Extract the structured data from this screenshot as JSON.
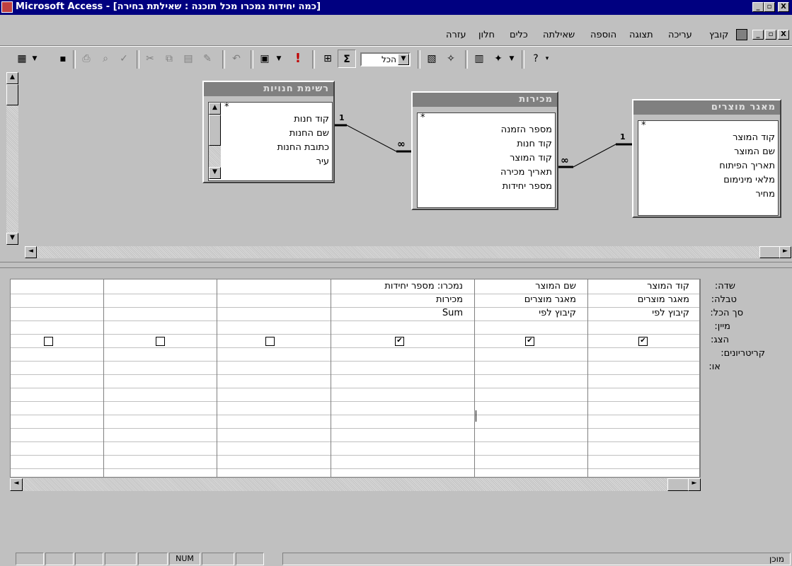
{
  "window": {
    "title": "Microsoft Access - [כמה יחידות נמכרו מכל תוכנה : שאילתת בחירה]",
    "controls": [
      "_",
      "▫",
      "X"
    ]
  },
  "menu": {
    "items": [
      "קובץ",
      "עריכה",
      "תצוגה",
      "הוספה",
      "שאילתה",
      "כלים",
      "חלון",
      "עזרה"
    ]
  },
  "toolbar": {
    "totals_combo_value": "הכל"
  },
  "tables": {
    "stores": {
      "title": "רשימת חנויות",
      "fields": [
        "*",
        "קוד חנות",
        "שם החנות",
        "כתובת החנות",
        "עיר"
      ]
    },
    "sales": {
      "title": "מכירות",
      "fields": [
        "*",
        "מספר הזמנה",
        "קוד חנות",
        "קוד המוצר",
        "תאריך מכירה",
        "מספר יחידות"
      ]
    },
    "products": {
      "title": "מאגר מוצרים",
      "fields": [
        "*",
        "קוד המוצר",
        "שם המוצר",
        "תאריך הפיתוח",
        "מלאי מינימום",
        "מחיר"
      ]
    }
  },
  "relations": {
    "one_label": "1",
    "many_label": "∞"
  },
  "grid": {
    "row_labels": [
      "שדה:",
      "טבלה:",
      "סך הכל:",
      "מיין:",
      "הצג:",
      "קריטריונים:",
      "או:"
    ],
    "columns": [
      {
        "field": "קוד המוצר",
        "table": "מאגר מוצרים",
        "total": "קיבוץ לפי",
        "show": true
      },
      {
        "field": "שם המוצר",
        "table": "מאגר מוצרים",
        "total": "קיבוץ לפי",
        "show": true
      },
      {
        "field": "נמכרו: מספר יחידות",
        "table": "מכירות",
        "total": "Sum",
        "show": true
      },
      {
        "field": "",
        "table": "",
        "total": "",
        "show": false
      },
      {
        "field": "",
        "table": "",
        "total": "",
        "show": false
      },
      {
        "field": "",
        "table": "",
        "total": "",
        "show": false
      }
    ]
  },
  "statusbar": {
    "ready": "מוכן",
    "num": "NUM"
  }
}
